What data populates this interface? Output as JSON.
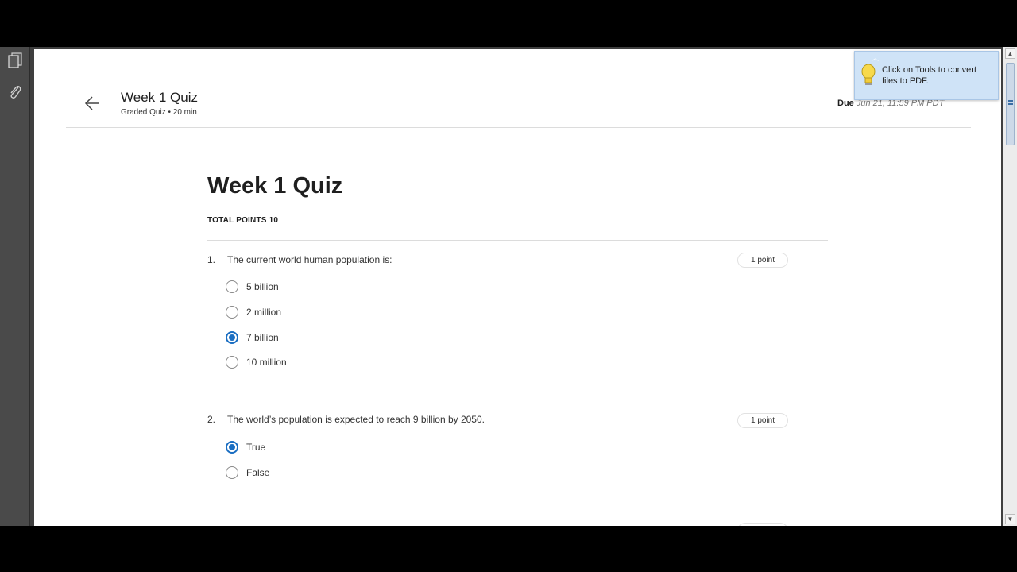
{
  "header": {
    "title": "Week 1 Quiz",
    "subtitle": "Graded Quiz • 20 min",
    "due_label": "Due",
    "due_value": "Jun 21, 11:59 PM PDT"
  },
  "quiz": {
    "title": "Week 1 Quiz",
    "total_points": "TOTAL POINTS 10",
    "questions": [
      {
        "number": "1.",
        "text": "The current world human population is:",
        "points": "1 point",
        "options": [
          {
            "label": "5 billion",
            "selected": false
          },
          {
            "label": "2 million",
            "selected": false
          },
          {
            "label": "7 billion",
            "selected": true
          },
          {
            "label": "10 million",
            "selected": false
          }
        ]
      },
      {
        "number": "2.",
        "text": "The world’s population is expected to reach 9 billion by 2050.",
        "points": "1 point",
        "options": [
          {
            "label": "True",
            "selected": true
          },
          {
            "label": "False",
            "selected": false
          }
        ]
      }
    ]
  },
  "tooltip": {
    "text": "Click on Tools to convert files to PDF."
  },
  "icons": {
    "back": "arrow-left-icon",
    "pages": "pages-icon",
    "attachments": "paperclip-icon",
    "tip": "lightbulb-icon"
  },
  "colors": {
    "accent": "#1a6ec2",
    "viewer_bg": "#3f3f3f",
    "tooltip_bg": "#cfe3f7"
  }
}
